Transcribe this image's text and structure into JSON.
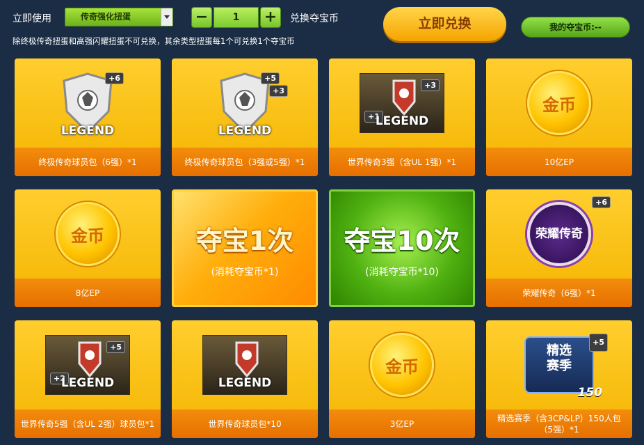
{
  "toolbar": {
    "use_label": "立即使用",
    "dropdown_value": "传奇强化扭蛋",
    "quantity": "1",
    "minus": "−",
    "plus": "+",
    "exchange_label": "兑换夺宝币",
    "notice": "除终极传奇扭蛋和高强闪耀扭蛋不可兑换，其余类型扭蛋每1个可兑换1个夺宝币",
    "redeem_button": "立即兑换",
    "my_coins": "我的夺宝币:--"
  },
  "cards": [
    {
      "caption": "终极传奇球员包（6强）*1",
      "plus": "+6",
      "word": "LEGEND"
    },
    {
      "caption": "终极传奇球员包（3强或5强）*1",
      "plus": "+5",
      "plus2": "+3",
      "word": "LEGEND"
    },
    {
      "caption": "世界传奇3强（含UL 1强）*1",
      "plus": "+3",
      "plus2": "+1",
      "word": "LEGEND"
    },
    {
      "caption": "10亿EP",
      "coin": "金币"
    },
    {
      "caption": "8亿EP",
      "coin": "金币"
    },
    {
      "big_title": "夺宝1次",
      "big_sub": "(消耗夺宝币*1)"
    },
    {
      "big_title": "夺宝10次",
      "big_sub": "(消耗夺宝币*10)"
    },
    {
      "caption": "荣耀传奇（6强）*1",
      "plus": "+6",
      "badge": "荣耀传奇"
    },
    {
      "caption": "世界传奇5强（含UL 2强）球员包*1",
      "plus": "+5",
      "plus2": "+2",
      "word": "LEGEND"
    },
    {
      "caption": "世界传奇球员包*10",
      "word": "LEGEND"
    },
    {
      "caption": "3亿EP",
      "coin": "金币"
    },
    {
      "caption": "精选赛季（含3CP&LP）150人包（5强）*1",
      "plus": "+5",
      "badge_l1": "精选",
      "badge_l2": "赛季",
      "badge_num": "150"
    }
  ]
}
